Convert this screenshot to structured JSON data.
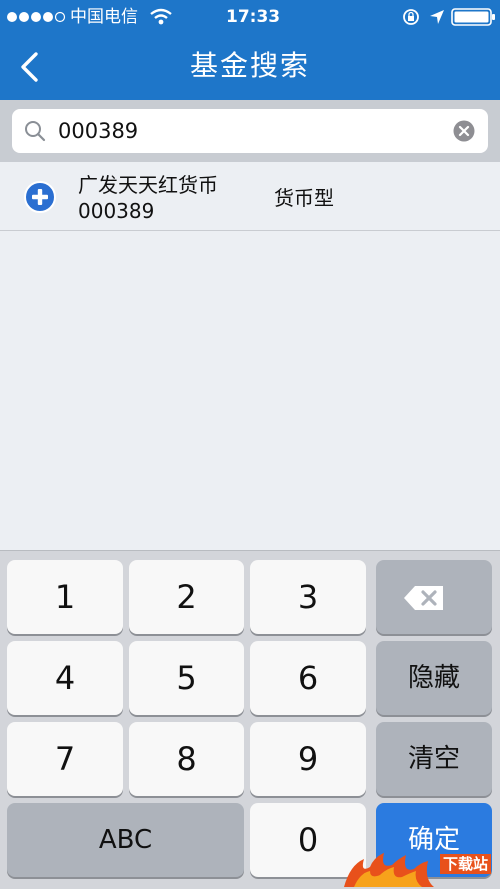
{
  "status": {
    "carrier": "中国电信",
    "time": "17:33"
  },
  "nav": {
    "title": "基金搜索"
  },
  "search": {
    "value": "000389"
  },
  "results": [
    {
      "name": "广发天天红货币",
      "code": "000389",
      "type": "货币型"
    }
  ],
  "keyboard": {
    "keys": [
      "1",
      "2",
      "3",
      "4",
      "5",
      "6",
      "7",
      "8",
      "9",
      "0"
    ],
    "hide": "隐藏",
    "clear": "清空",
    "abc": "ABC",
    "confirm": "确定"
  },
  "watermark": {
    "text": "下载站"
  },
  "colors": {
    "primary": "#1e76c9",
    "accent": "#2b7be0"
  }
}
